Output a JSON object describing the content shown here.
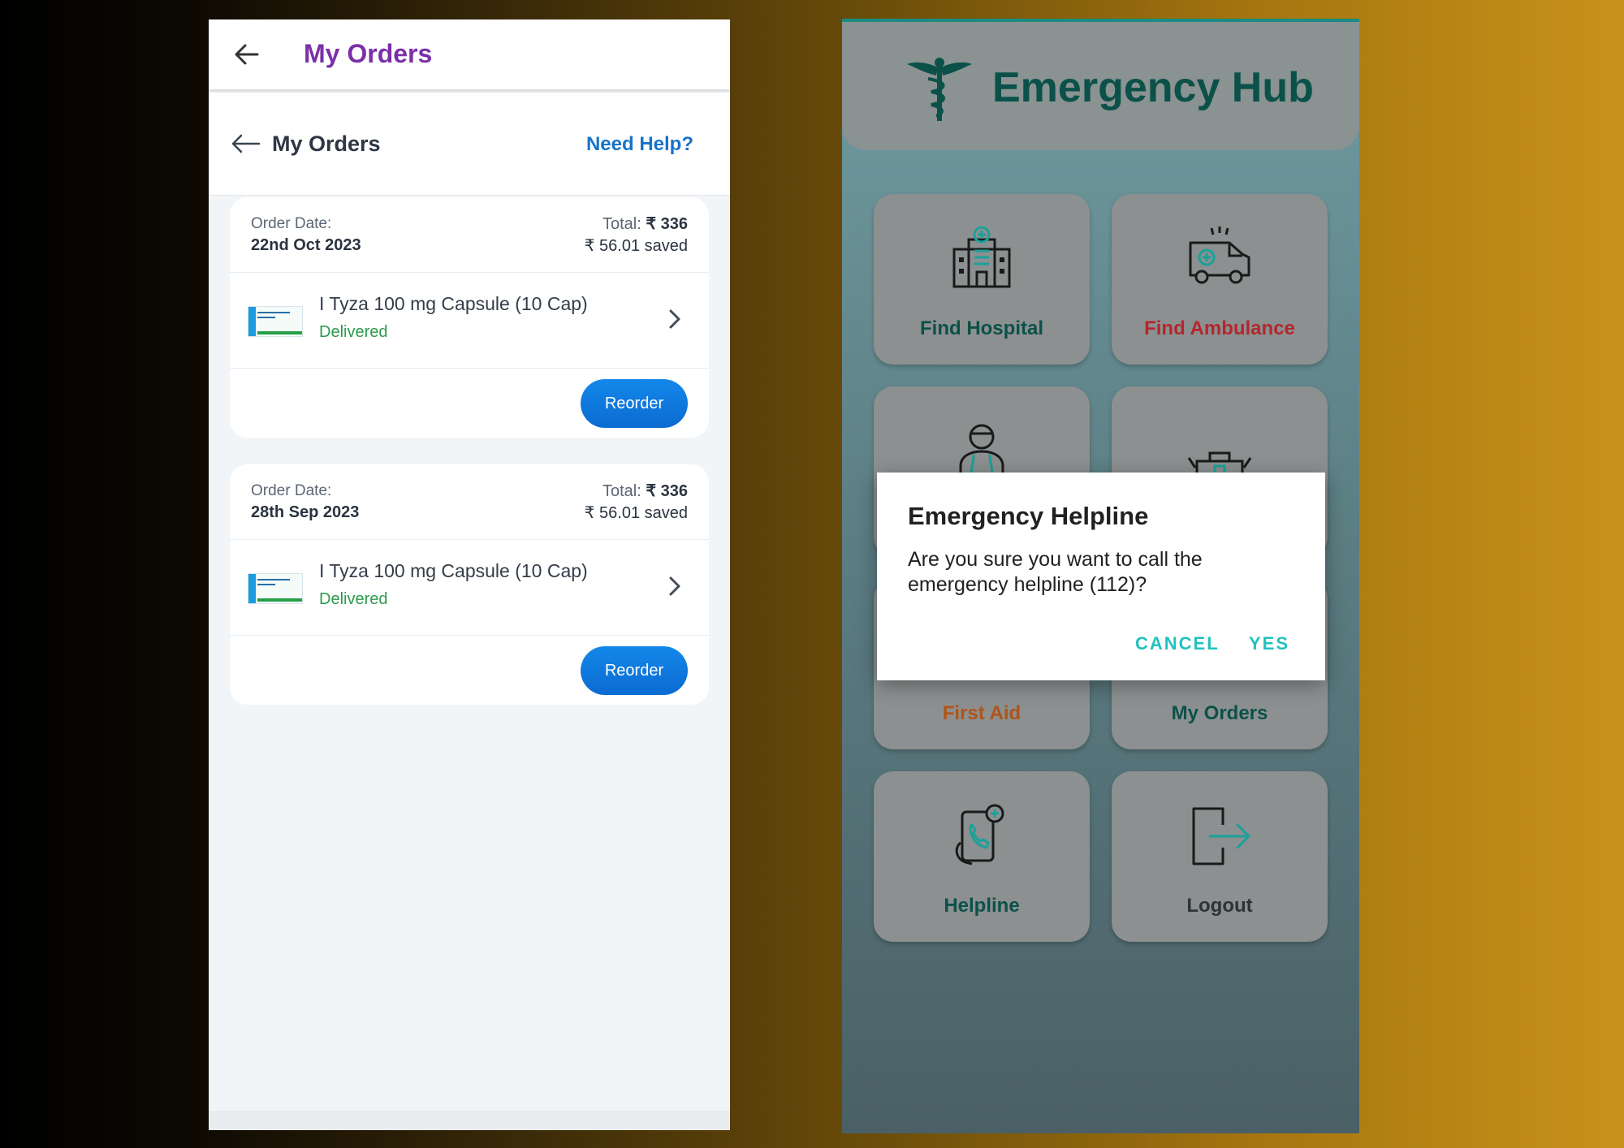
{
  "orders_screen": {
    "appbar_title": "My Orders",
    "subheader_title": "My Orders",
    "help_label": "Need Help?",
    "orders": [
      {
        "date_label": "Order Date:",
        "date": "22nd Oct 2023",
        "total_label": "Total:",
        "total": "₹ 336",
        "saved": "₹ 56.01 saved",
        "item": "I Tyza 100 mg Capsule (10 Cap)",
        "status": "Delivered",
        "reorder_label": "Reorder"
      },
      {
        "date_label": "Order Date:",
        "date": "28th Sep 2023",
        "total_label": "Total:",
        "total": "₹ 336",
        "saved": "₹ 56.01 saved",
        "item": "I Tyza 100 mg Capsule (10 Cap)",
        "status": "Delivered",
        "reorder_label": "Reorder"
      }
    ]
  },
  "hub_screen": {
    "title": "Emergency Hub",
    "tiles": [
      {
        "label": "Find Hospital",
        "icon": "hospital-icon",
        "color": "#0b5149"
      },
      {
        "label": "Find Ambulance",
        "icon": "ambulance-icon",
        "color": "#b3262e"
      },
      {
        "label": "",
        "icon": "doctor-icon",
        "color": "#0b5149"
      },
      {
        "label": "",
        "icon": "first-aid-kit-icon",
        "color": "#0b5149"
      },
      {
        "label": "First Aid",
        "icon": "first-aid-icon",
        "color": "#b0541a"
      },
      {
        "label": "My Orders",
        "icon": "orders-icon",
        "color": "#0b5149"
      },
      {
        "label": "Helpline",
        "icon": "phone-call-icon",
        "color": "#0b5149"
      },
      {
        "label": "Logout",
        "icon": "logout-icon",
        "color": "#2d3436"
      }
    ],
    "dialog": {
      "title": "Emergency Helpline",
      "message": "Are you sure you want to call the emergency helpline (112)?",
      "cancel_label": "CANCEL",
      "yes_label": "YES"
    }
  }
}
